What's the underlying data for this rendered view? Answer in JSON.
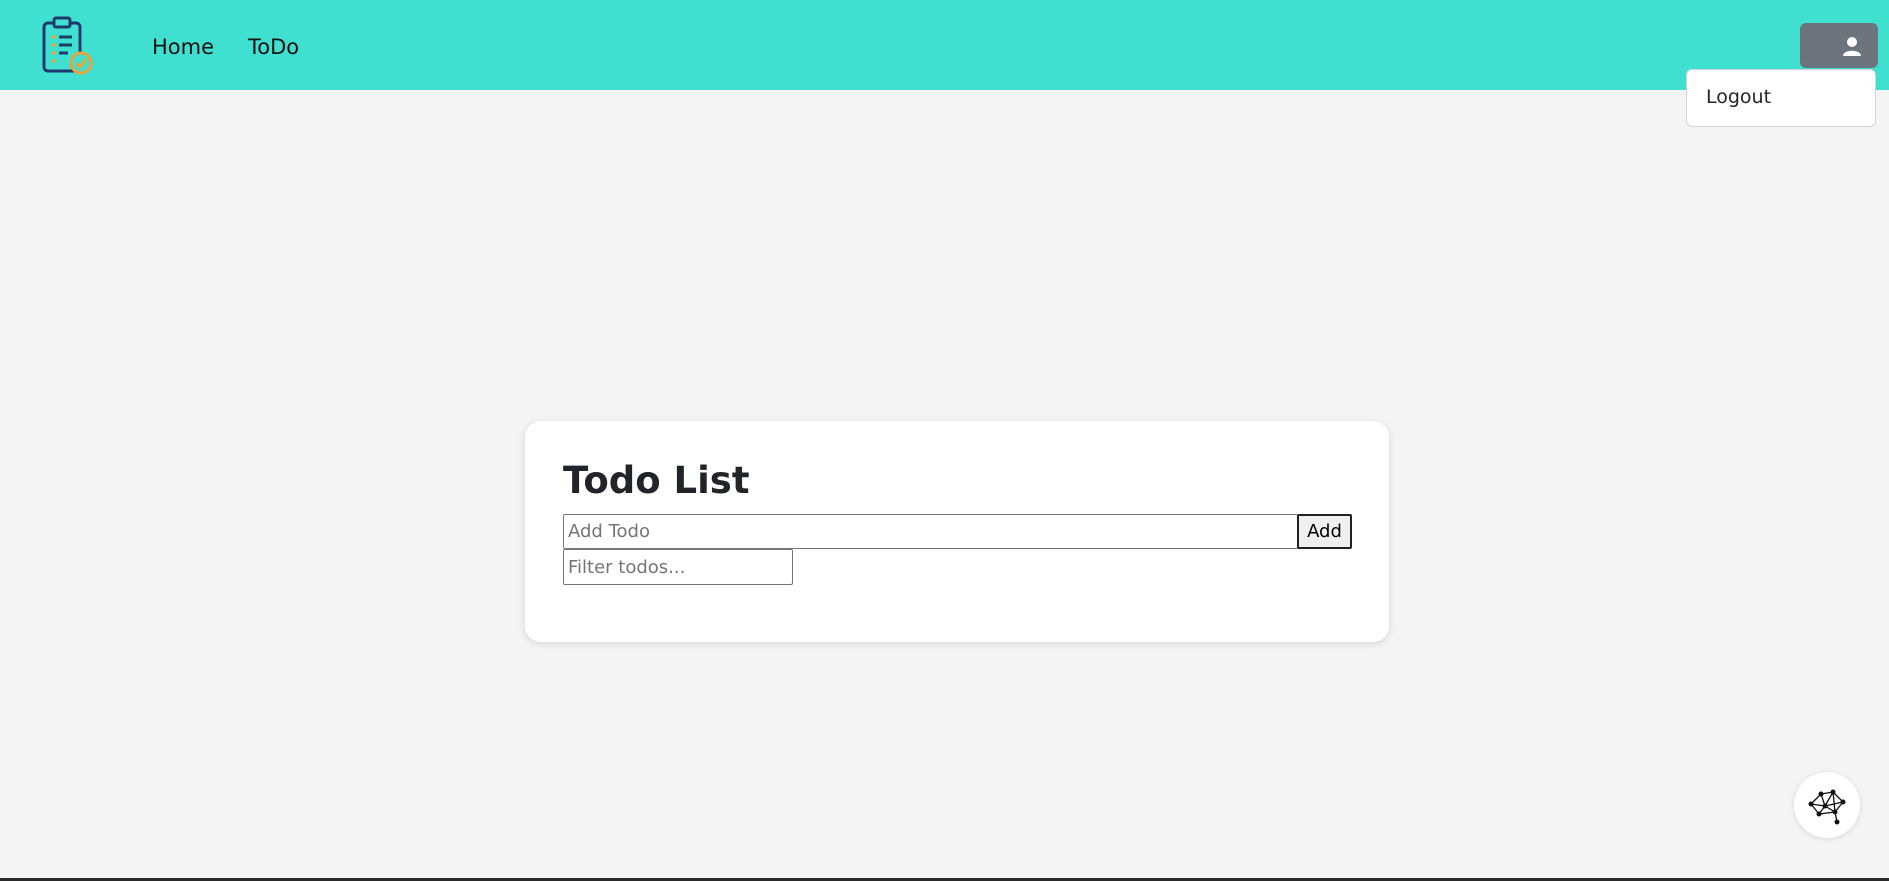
{
  "navbar": {
    "logo_icon": "clipboard-check-icon",
    "links": [
      "Home",
      "ToDo"
    ],
    "bg_color": "#40e0d0",
    "user_icon": "user-icon"
  },
  "user_menu": {
    "items": [
      "Logout"
    ]
  },
  "todo": {
    "title": "Todo List",
    "add_placeholder": "Add Todo",
    "add_label": "Add",
    "filter_placeholder": "Filter todos..."
  },
  "floating_button": {
    "icon": "network-graph-icon"
  }
}
